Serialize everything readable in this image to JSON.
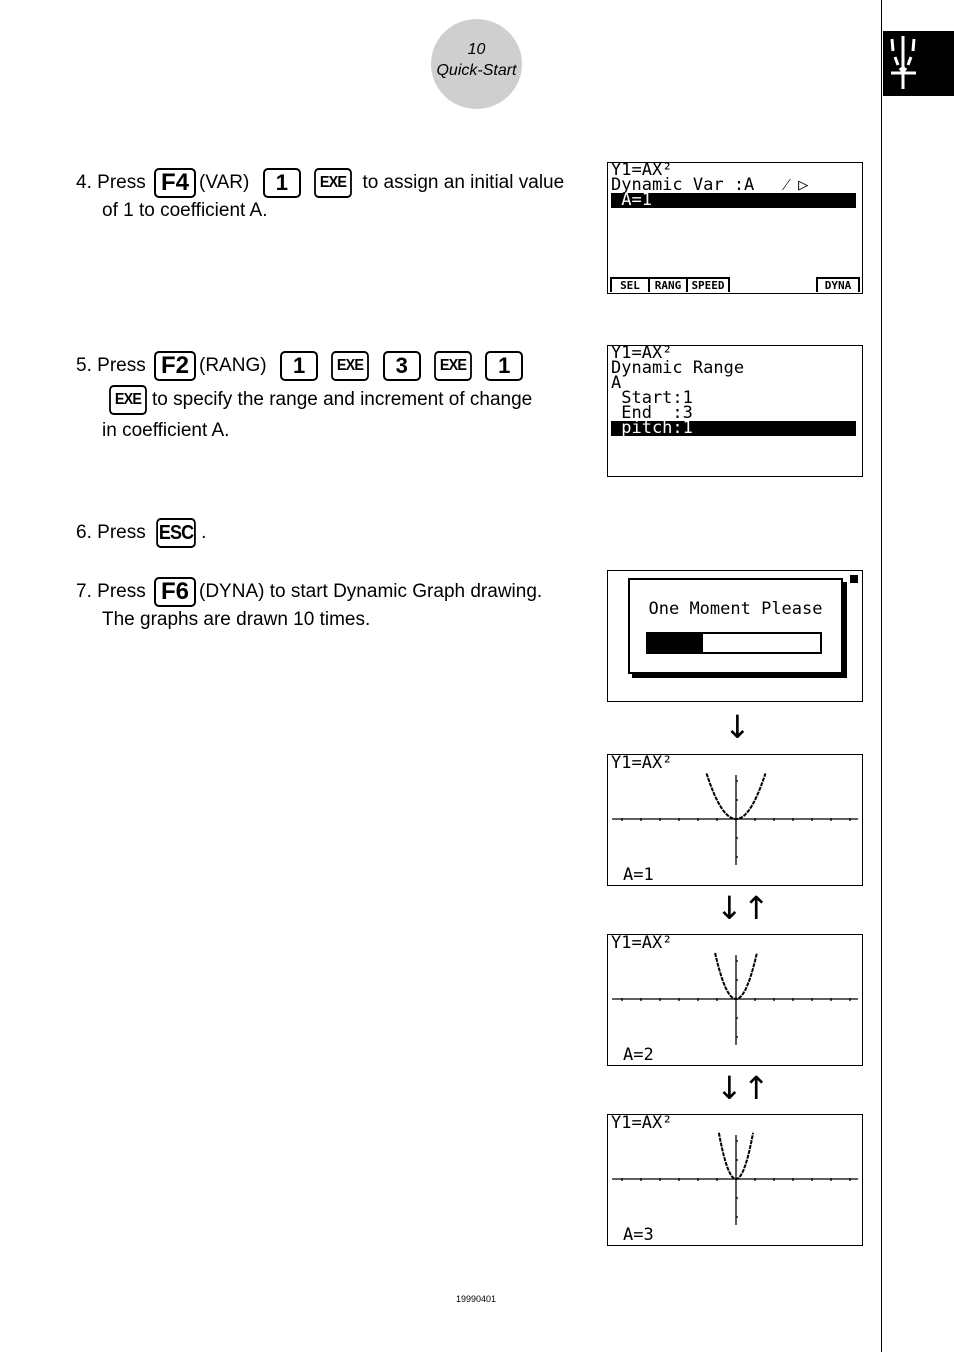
{
  "page": {
    "number": "10",
    "section": "Quick-Start",
    "footer_code": "19990401",
    "tab_icon": "dynamic-graph-icon"
  },
  "steps": [
    {
      "num": "4.",
      "press": "Press",
      "key1": "F4",
      "paren1": "(VAR)",
      "key2": "1",
      "key3": "EXE",
      "text1": "to assign an initial value",
      "text2": "of 1 to coefficient A."
    },
    {
      "num": "5.",
      "press": "Press",
      "key1": "F2",
      "paren1": "(RANG)",
      "keys": [
        "1",
        "EXE",
        "3",
        "EXE",
        "1",
        "EXE"
      ],
      "text1": "to specify the range and increment of change",
      "text2": "in coefficient A."
    },
    {
      "num": "6.",
      "press": "Press",
      "key1": "ESC",
      "text1": "."
    },
    {
      "num": "7.",
      "press": "Press",
      "key1": "F6",
      "paren1": "(DYNA)",
      "text1": "to start Dynamic Graph drawing.",
      "text2": "The graphs are drawn 10 times."
    }
  ],
  "screens": {
    "dynamic_var": {
      "lines": [
        "Y1=AX²",
        "Dynamic Var :A   ⁄ ▷"
      ],
      "selected": " A=1",
      "softkeys": [
        "SEL",
        "RANG",
        "SPEED",
        "DYNA"
      ]
    },
    "dynamic_range": {
      "lines": [
        "Y1=AX²",
        "Dynamic Range",
        "A",
        " Start:1",
        " End  :3"
      ],
      "selected": " pitch:1"
    },
    "wait": {
      "message": "One Moment Please",
      "progress_fraction": 0.32
    },
    "graphs": [
      {
        "title": "Y1=AX²",
        "label": "A=1",
        "a": 1
      },
      {
        "title": "Y1=AX²",
        "label": "A=2",
        "a": 2
      },
      {
        "title": "Y1=AX²",
        "label": "A=3",
        "a": 3
      }
    ]
  },
  "arrows": {
    "down": "↓",
    "down_up": "↓↑"
  }
}
